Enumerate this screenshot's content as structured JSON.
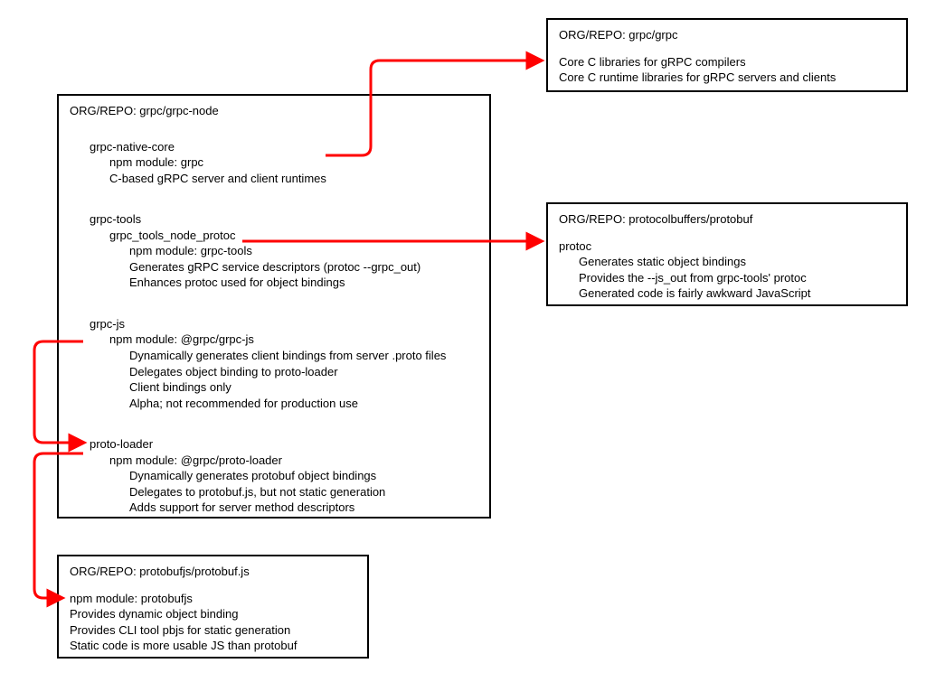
{
  "colors": {
    "arrow": "#ff0000",
    "border": "#000000"
  },
  "main_repo": {
    "title": "ORG/REPO: grpc/grpc-node",
    "sections": {
      "grpc_native_core": {
        "name": "grpc-native-core",
        "npm": "npm module: grpc",
        "desc1": "C-based gRPC server and client runtimes"
      },
      "grpc_tools": {
        "name": "grpc-tools",
        "sub": "grpc_tools_node_protoc",
        "npm": "npm module: grpc-tools",
        "desc1": "Generates gRPC service descriptors (protoc --grpc_out)",
        "desc2": "Enhances protoc used for object bindings"
      },
      "grpc_js": {
        "name": "grpc-js",
        "npm": "npm module: @grpc/grpc-js",
        "desc1": "Dynamically generates client bindings from server .proto files",
        "desc2": "Delegates object binding to proto-loader",
        "desc3": "Client bindings only",
        "desc4": "Alpha; not recommended for production use"
      },
      "proto_loader": {
        "name": "proto-loader",
        "npm": "npm module: @grpc/proto-loader",
        "desc1": "Dynamically generates protobuf object bindings",
        "desc2": "Delegates to protobuf.js, but not static generation",
        "desc3": "Adds support for server method descriptors"
      }
    }
  },
  "grpc_repo": {
    "title": "ORG/REPO: grpc/grpc",
    "desc1": "Core C libraries for gRPC compilers",
    "desc2": "Core C runtime libraries for gRPC servers and clients"
  },
  "protobuf_repo": {
    "title": "ORG/REPO: protocolbuffers/protobuf",
    "sub": "protoc",
    "desc1": "Generates static object bindings",
    "desc2": "Provides the --js_out from grpc-tools' protoc",
    "desc3": "Generated code is fairly awkward JavaScript"
  },
  "protobufjs_repo": {
    "title": "ORG/REPO: protobufjs/protobuf.js",
    "npm": "npm module: protobufjs",
    "desc1": "Provides dynamic object binding",
    "desc2": "Provides CLI tool pbjs for static generation",
    "desc3": "Static code is more usable JS than protobuf"
  }
}
